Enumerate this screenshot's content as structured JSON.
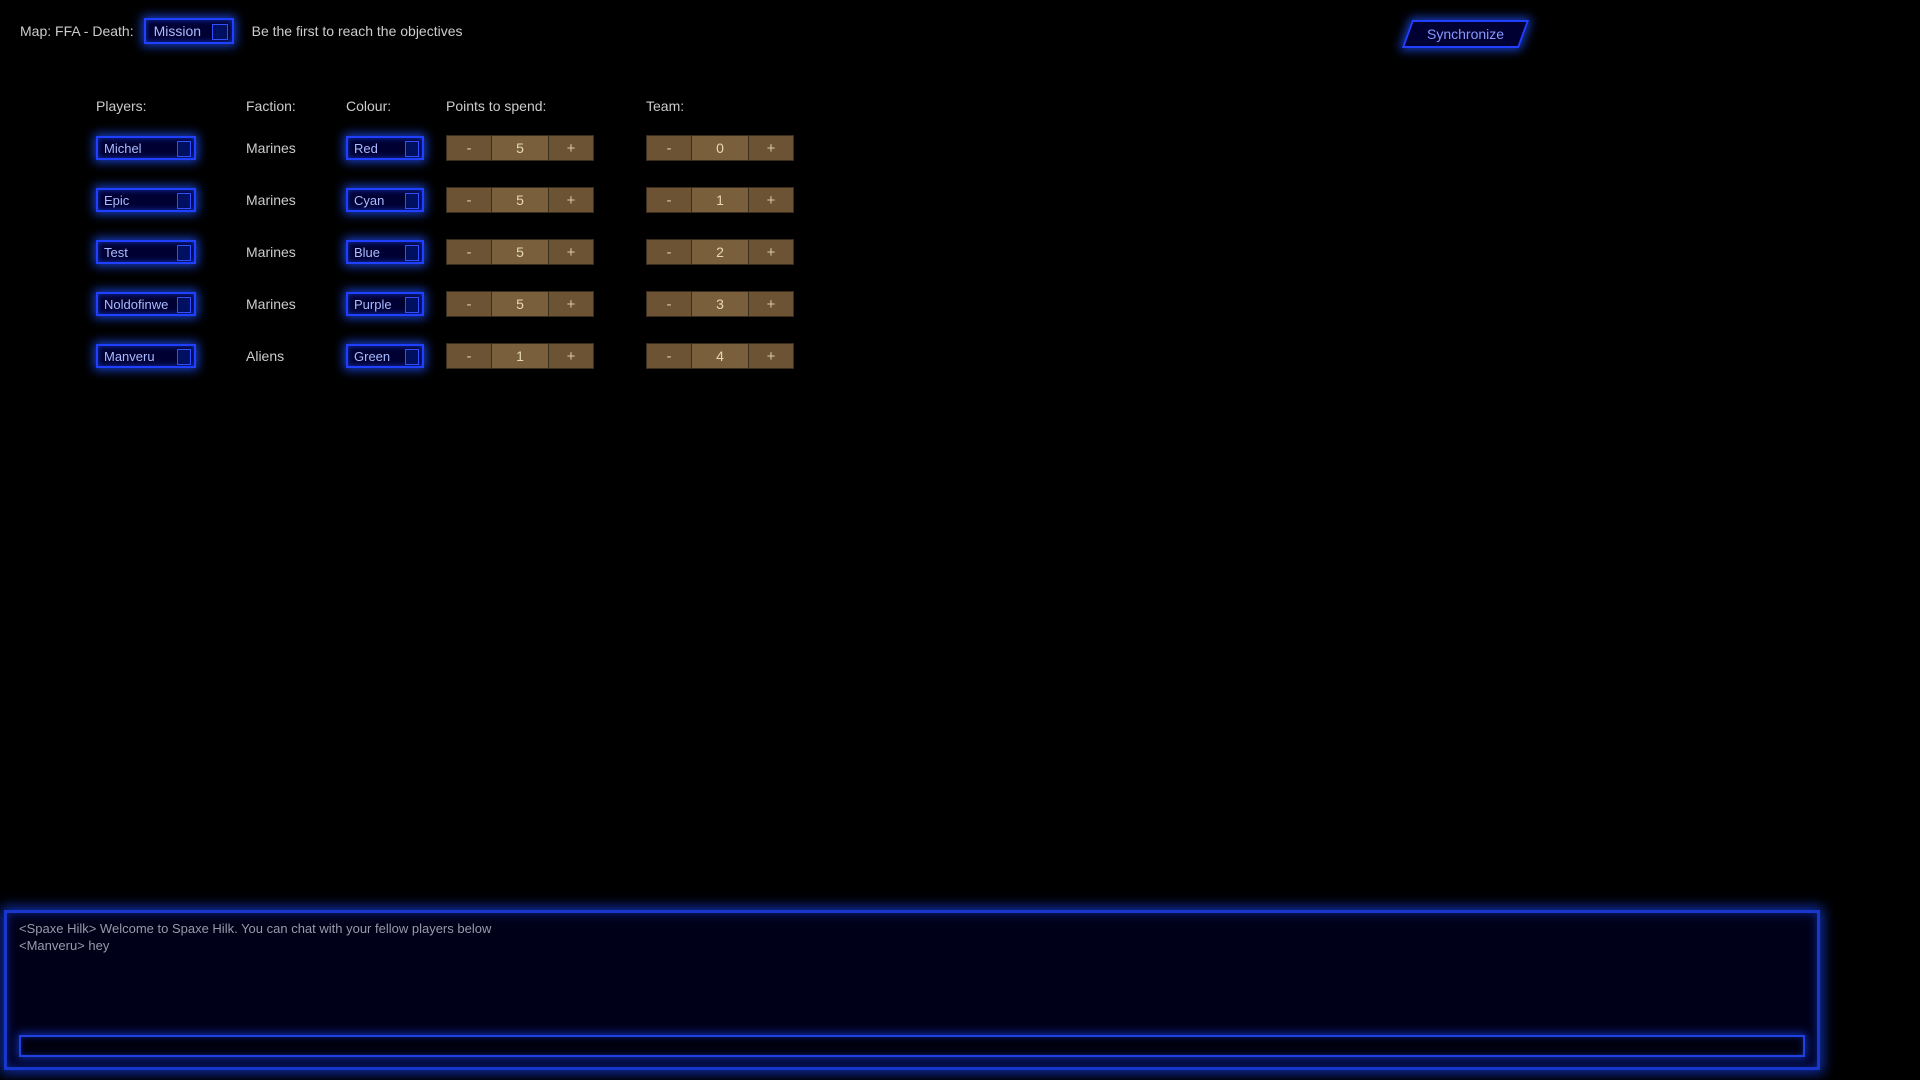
{
  "topbar": {
    "map_label": "Map: FFA - Death:",
    "mission_select": "Mission",
    "mission_desc": "Be the first to reach the objectives",
    "sync_label": "Synchronize"
  },
  "headers": {
    "players": "Players:",
    "faction": "Faction:",
    "colour": "Colour:",
    "points": "Points to spend:",
    "team": "Team:"
  },
  "stepper": {
    "minus": "-",
    "plus": "+"
  },
  "players": [
    {
      "name": "Michel",
      "faction": "Marines",
      "colour": "Red",
      "points": "5",
      "team": "0"
    },
    {
      "name": "Epic",
      "faction": "Marines",
      "colour": "Cyan",
      "points": "5",
      "team": "1"
    },
    {
      "name": "Test",
      "faction": "Marines",
      "colour": "Blue",
      "points": "5",
      "team": "2"
    },
    {
      "name": "Noldofinwe",
      "faction": "Marines",
      "colour": "Purple",
      "points": "5",
      "team": "3"
    },
    {
      "name": "Manveru",
      "faction": "Aliens",
      "colour": "Green",
      "points": "1",
      "team": "4"
    }
  ],
  "chat": {
    "lines": [
      "<Spaxe Hilk> Welcome to Spaxe Hilk. You can chat with your fellow players below",
      "<Manveru> hey"
    ],
    "input_value": ""
  }
}
